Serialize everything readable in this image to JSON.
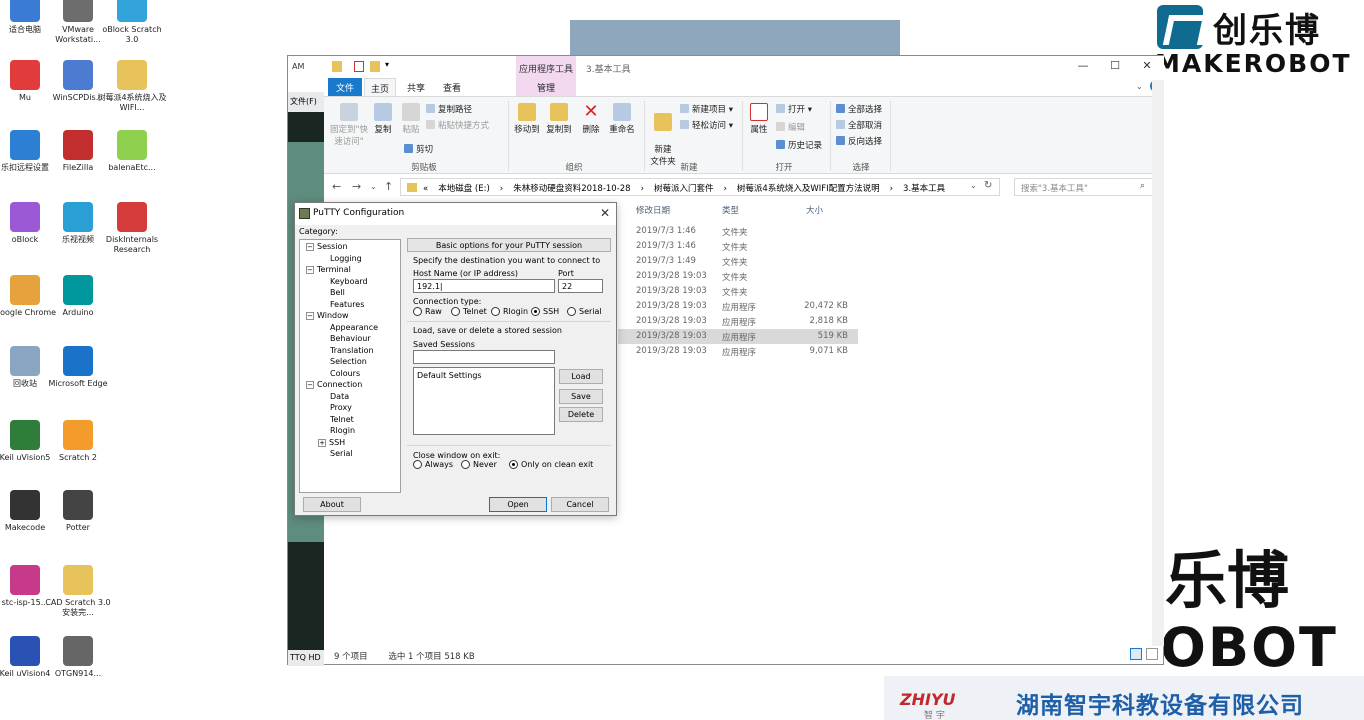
{
  "desktop_icons": [
    {
      "label": "适合电脑",
      "color": "#3a7bd5"
    },
    {
      "label": "VMware Workstati...",
      "color": "#6d6d6d"
    },
    {
      "label": "oBlock Scratch 3.0",
      "color": "#33a3dc"
    },
    {
      "label": "Mu",
      "color": "#e23b3b"
    },
    {
      "label": "WinSCPDis...",
      "color": "#4c7bd1"
    },
    {
      "label": "树莓派4系统烧入及WIFI...",
      "color": "#e8c35b"
    },
    {
      "label": "乐扣远程设置",
      "color": "#2d7fd3"
    },
    {
      "label": "FileZilla",
      "color": "#c22d2d"
    },
    {
      "label": "balenaEtc...",
      "color": "#8fd14f"
    },
    {
      "label": "oBlock",
      "color": "#9b59d6"
    },
    {
      "label": "乐视视频",
      "color": "#2a9fd6"
    },
    {
      "label": "DiskInternals Research",
      "color": "#d63b3b"
    },
    {
      "label": "Google Chrome",
      "color": "#e6a23c"
    },
    {
      "label": "Arduino",
      "color": "#00979d"
    },
    {
      "label": "回收站",
      "color": "#8aa5c2"
    },
    {
      "label": "Microsoft Edge",
      "color": "#1a73c9"
    },
    {
      "label": "Keil uVision5",
      "color": "#2f7d3a"
    },
    {
      "label": "Scratch 2",
      "color": "#f39c2b"
    },
    {
      "label": "Makecode",
      "color": "#333333"
    },
    {
      "label": "Potter",
      "color": "#444444"
    },
    {
      "label": "stc-isp-15...",
      "color": "#c73a8a"
    },
    {
      "label": "CAD Scratch 3.0安装完...",
      "color": "#e8c35b"
    },
    {
      "label": "Keil uVision4",
      "color": "#2a52b5"
    },
    {
      "label": "OTGN914...",
      "color": "#666666"
    }
  ],
  "brand": {
    "cn": "创乐博",
    "en": "MAKEROBOT",
    "big_cn": "乐博",
    "big_en": "OBOT",
    "bottom_logo": "ZHIYU",
    "bottom_sub": "智  宇",
    "company": "湖南智宇科教设备有限公司"
  },
  "explorer": {
    "title": "3.基本工具",
    "context_tab": "应用程序工具",
    "left_strip_top": "AM",
    "left_strip_file": "文件(F)",
    "left_strip_bottom": "TTQ HD",
    "tabs": [
      "文件",
      "主页",
      "共享",
      "查看",
      "管理"
    ],
    "ribbon": {
      "pin": "固定到\"快速访问\"",
      "copy": "复制",
      "paste": "粘贴",
      "copy_path": "复制路径",
      "paste_shortcut": "粘贴快捷方式",
      "cut": "剪切",
      "move_to": "移动到",
      "copy_to": "复制到",
      "delete": "删除",
      "rename": "重命名",
      "new_folder": "新建\n文件夹",
      "new_item": "新建项目",
      "easy_access": "轻松访问",
      "properties": "属性",
      "open": "打开",
      "edit": "编辑",
      "history": "历史记录",
      "select_all": "全部选择",
      "select_none": "全部取消",
      "invert": "反向选择",
      "groups": [
        "剪贴板",
        "组织",
        "新建",
        "打开",
        "选择"
      ]
    },
    "address": [
      "«",
      "本地磁盘 (E:)",
      "›",
      "朱林移动硬盘资料2018-10-28",
      "›",
      "树莓派入门套件",
      "›",
      "树莓派4系统烧入及WIFI配置方法说明",
      "›",
      "3.基本工具"
    ],
    "search_placeholder": "搜索\"3.基本工具\"",
    "columns": [
      "修改日期",
      "类型",
      "大小"
    ],
    "files": [
      {
        "date": "2019/7/3 1:46",
        "type": "文件夹",
        "size": ""
      },
      {
        "date": "2019/7/3 1:46",
        "type": "文件夹",
        "size": ""
      },
      {
        "date": "2019/7/3 1:49",
        "type": "文件夹",
        "size": ""
      },
      {
        "date": "2019/3/28 19:03",
        "type": "文件夹",
        "size": ""
      },
      {
        "date": "2019/3/28 19:03",
        "type": "文件夹",
        "size": ""
      },
      {
        "date": "2019/3/28 19:03",
        "type": "应用程序",
        "size": "20,472 KB"
      },
      {
        "date": "2019/3/28 19:03",
        "type": "应用程序",
        "size": "2,818 KB"
      },
      {
        "date": "2019/3/28 19:03",
        "type": "应用程序",
        "size": "519 KB"
      },
      {
        "date": "2019/3/28 19:03",
        "type": "应用程序",
        "size": "9,071 KB"
      }
    ],
    "status": [
      "9 个项目",
      "选中 1 个项目  518 KB"
    ]
  },
  "putty": {
    "title": "PuTTY Configuration",
    "category": "Category:",
    "tree": [
      {
        "label": "Session",
        "level": 0,
        "exp": "−"
      },
      {
        "label": "Logging",
        "level": 2,
        "exp": ""
      },
      {
        "label": "Terminal",
        "level": 0,
        "exp": "−"
      },
      {
        "label": "Keyboard",
        "level": 1,
        "exp": ""
      },
      {
        "label": "Bell",
        "level": 1,
        "exp": ""
      },
      {
        "label": "Features",
        "level": 1,
        "exp": ""
      },
      {
        "label": "Window",
        "level": 0,
        "exp": "−"
      },
      {
        "label": "Appearance",
        "level": 1,
        "exp": ""
      },
      {
        "label": "Behaviour",
        "level": 1,
        "exp": ""
      },
      {
        "label": "Translation",
        "level": 1,
        "exp": ""
      },
      {
        "label": "Selection",
        "level": 1,
        "exp": ""
      },
      {
        "label": "Colours",
        "level": 1,
        "exp": ""
      },
      {
        "label": "Connection",
        "level": 0,
        "exp": "−"
      },
      {
        "label": "Data",
        "level": 1,
        "exp": ""
      },
      {
        "label": "Proxy",
        "level": 1,
        "exp": ""
      },
      {
        "label": "Telnet",
        "level": 1,
        "exp": ""
      },
      {
        "label": "Rlogin",
        "level": 1,
        "exp": ""
      },
      {
        "label": "SSH",
        "level": 1,
        "exp": "+"
      },
      {
        "label": "Serial",
        "level": 1,
        "exp": ""
      }
    ],
    "panel_title": "Basic options for your PuTTY session",
    "dest_label": "Specify the destination you want to connect to",
    "host_label": "Host Name (or IP address)",
    "host_value": "192.1|",
    "port_label": "Port",
    "port_value": "22",
    "conn_type_label": "Connection type:",
    "conn_types": [
      "Raw",
      "Telnet",
      "Rlogin",
      "SSH",
      "Serial"
    ],
    "conn_selected": "SSH",
    "lsd_label": "Load, save or delete a stored session",
    "saved_label": "Saved Sessions",
    "saved_value": "",
    "sessions": [
      "Default Settings"
    ],
    "load": "Load",
    "save": "Save",
    "delete": "Delete",
    "close_label": "Close window on exit:",
    "close_opts": [
      "Always",
      "Never",
      "Only on clean exit"
    ],
    "close_selected": "Only on clean exit",
    "about": "About",
    "open": "Open",
    "cancel": "Cancel"
  }
}
